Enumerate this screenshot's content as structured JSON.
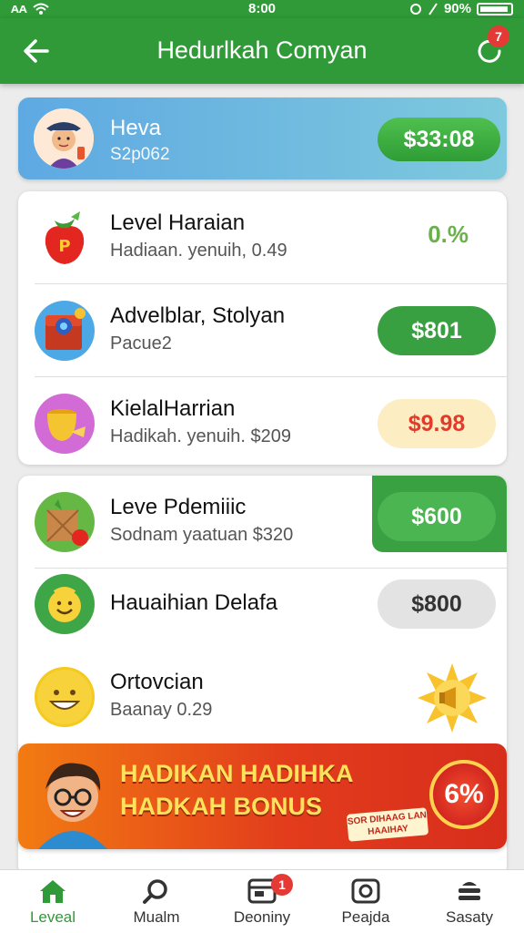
{
  "status_bar": {
    "left": "ᴀᴀ",
    "time": "8:00",
    "battery": "90%"
  },
  "app_bar": {
    "title": "Hedurlkah Comyan",
    "notification_count": "7"
  },
  "profile": {
    "name": "Heva",
    "sub": "S2p062",
    "amount": "$33:08"
  },
  "list_one": [
    {
      "title": "Level Haraian",
      "sub": "Hadiaan. yenuih, 0.49",
      "value": "0.%",
      "icon": "strawberry-icon"
    },
    {
      "title": "Advelblar, Stolyan",
      "sub": "Pacue2",
      "value": "$801",
      "icon": "treasure-box-icon"
    },
    {
      "title": "KielalHarrian",
      "sub": "Hadikah. yenuih. $209",
      "value": "$9.98",
      "icon": "golden-pot-icon"
    }
  ],
  "list_two": [
    {
      "title": "Leve Pdemiiic",
      "sub": "Sodnam yaatuan $320",
      "value": "$600",
      "icon": "gift-crate-icon"
    },
    {
      "title": "Hauaihian Delafa",
      "sub": "",
      "value": "$800",
      "icon": "smiley-badge-icon"
    },
    {
      "title": "Ortovcian",
      "sub": "Baanay 0.29",
      "value": "",
      "icon": "smiley-coin-icon"
    }
  ],
  "banner": {
    "line1": "HADIKAN HADIHKA",
    "line2": "HADKAH BONUS",
    "tag": "SOR DIHAAG LAN HAAIHAY",
    "badge": "6%"
  },
  "bottom_nav": [
    {
      "label": "Leveal",
      "icon": "home-icon",
      "active": true
    },
    {
      "label": "Mualm",
      "icon": "search-icon",
      "active": false
    },
    {
      "label": "Deoniny",
      "icon": "inbox-icon",
      "active": false,
      "badge": "1"
    },
    {
      "label": "Peajda",
      "icon": "camera-icon",
      "active": false
    },
    {
      "label": "Sasaty",
      "icon": "stack-icon",
      "active": false
    }
  ],
  "colors": {
    "primary": "#2f9a37",
    "accent_red": "#e53935",
    "banner_orange": "#f27b12"
  }
}
